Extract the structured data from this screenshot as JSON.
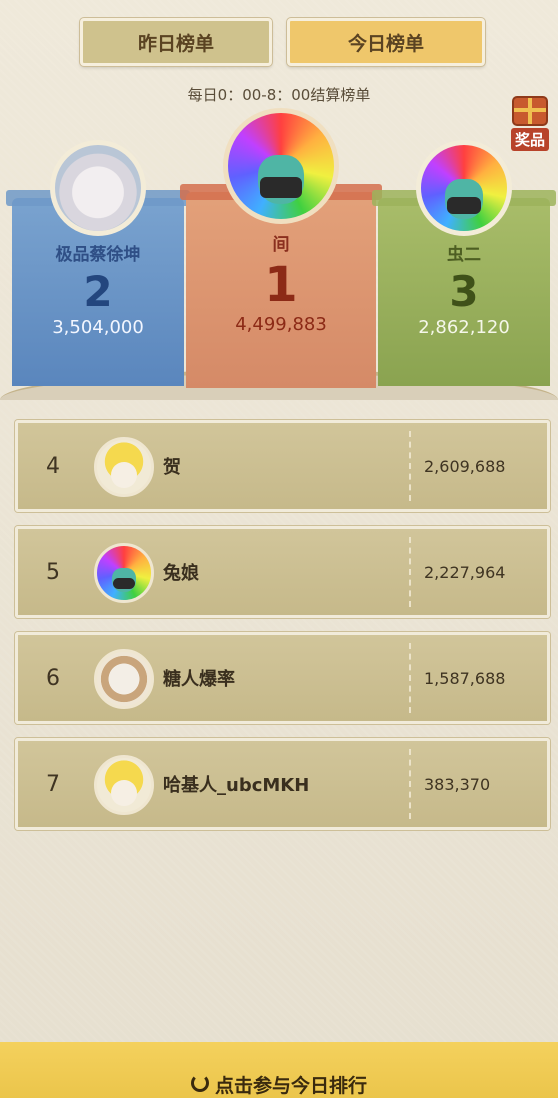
{
  "tabs": [
    {
      "label": "昨日榜单",
      "active": false
    },
    {
      "label": "今日榜单",
      "active": true
    }
  ],
  "settle_note": "每日0：00-8：00结算榜单",
  "prize_label": "奖品",
  "podium": [
    {
      "rank": "2",
      "name": "极品蔡徐坤",
      "score": "3,504,000",
      "avatar": "white-hair-avatar"
    },
    {
      "rank": "1",
      "name": "间",
      "score": "4,499,883",
      "avatar": "rainbow-hair-avatar"
    },
    {
      "rank": "3",
      "name": "虫二",
      "score": "2,862,120",
      "avatar": "rainbow-hair-avatar"
    }
  ],
  "list": [
    {
      "rank": "4",
      "name": "贺",
      "score": "2,609,688",
      "avatar": "banana-cat-avatar"
    },
    {
      "rank": "5",
      "name": "兔娘",
      "score": "2,227,964",
      "avatar": "rainbow-hair-avatar"
    },
    {
      "rank": "6",
      "name": "糖人爆率",
      "score": "1,587,688",
      "avatar": "cat-avatar"
    },
    {
      "rank": "7",
      "name": "哈基人_ubcMKH",
      "score": "383,370",
      "avatar": "banana-cat-avatar"
    }
  ],
  "bottom": {
    "label": "点击参与今日排行"
  },
  "colors": {
    "tab_active": "#efc76b",
    "tab_inactive": "#cfc28d",
    "podium_2": "#6f99c8",
    "podium_1": "#d58a67",
    "podium_3": "#9cb35c",
    "bottom_bar": "#f0cb54"
  }
}
